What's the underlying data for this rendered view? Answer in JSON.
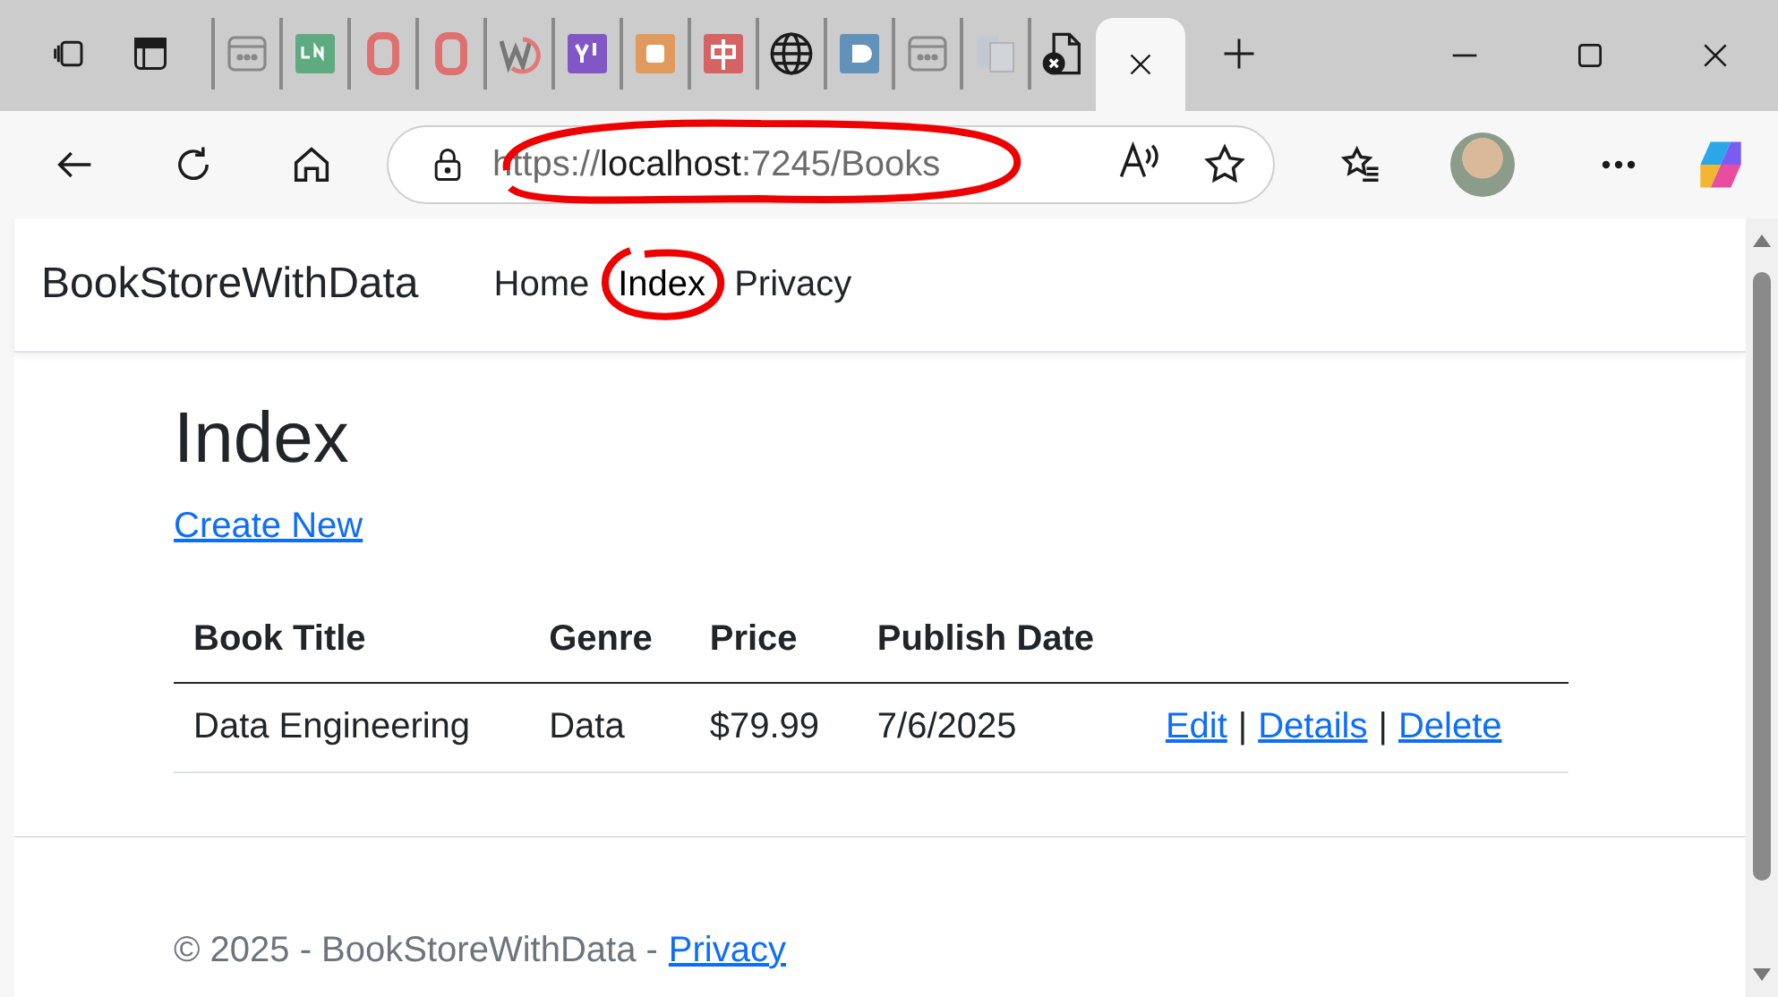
{
  "browser": {
    "tabs": [
      {
        "kind": "page",
        "selected": false
      },
      {
        "kind": "green",
        "selected": false
      },
      {
        "kind": "ring",
        "selected": false
      },
      {
        "kind": "ring",
        "selected": false
      },
      {
        "kind": "swoosh",
        "selected": false
      },
      {
        "kind": "purple",
        "selected": false
      },
      {
        "kind": "orange",
        "selected": false
      },
      {
        "kind": "red",
        "selected": false
      },
      {
        "kind": "globe",
        "selected": false
      },
      {
        "kind": "blue",
        "selected": false
      },
      {
        "kind": "page",
        "selected": false
      },
      {
        "kind": "files",
        "selected": false
      },
      {
        "kind": "doc-x",
        "selected": false
      },
      {
        "kind": "blank",
        "selected": true
      }
    ],
    "url": {
      "scheme": "https://",
      "host": "localhost",
      "rest": ":7245/Books"
    }
  },
  "page": {
    "brand": "BookStoreWithData",
    "nav": [
      {
        "label": "Home",
        "selected": false
      },
      {
        "label": "Index",
        "selected": true
      },
      {
        "label": "Privacy",
        "selected": false
      }
    ],
    "heading": "Index",
    "create_link": "Create New",
    "table": {
      "columns": [
        "Book Title",
        "Genre",
        "Price",
        "Publish Date"
      ],
      "rows": [
        {
          "cells": [
            "Data Engineering",
            "Data",
            "$79.99",
            "7/6/2025"
          ],
          "actions": [
            "Edit",
            "Details",
            "Delete"
          ],
          "separator": "|"
        }
      ]
    },
    "footer": {
      "text": "© 2025 - BookStoreWithData -",
      "link": "Privacy"
    }
  }
}
